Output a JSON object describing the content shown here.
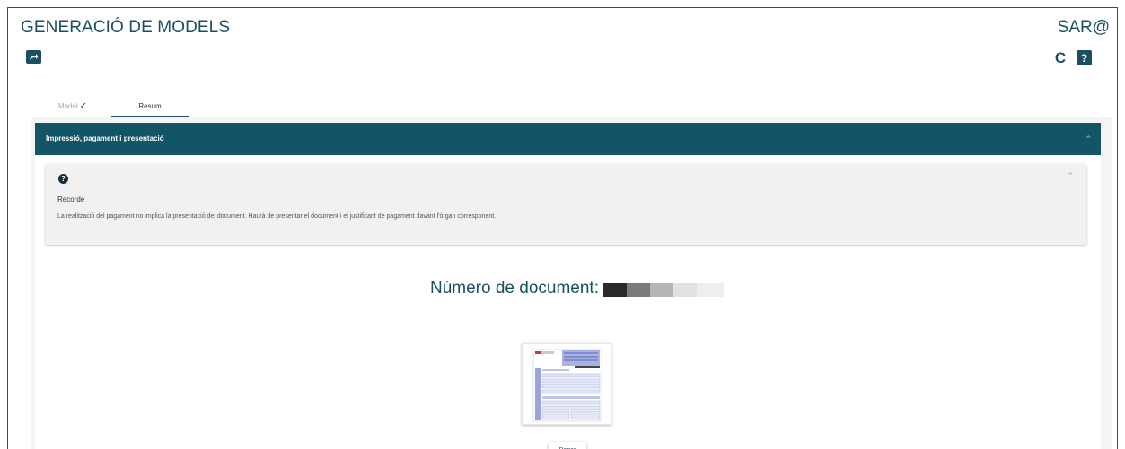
{
  "header": {
    "title": "GENERACIÓ DE MODELS",
    "brand": "SAR@"
  },
  "toolbar": {
    "export_icon": "export-icon",
    "refresh_icon": "refresh-icon",
    "refresh_glyph": "C",
    "help_icon": "help-icon",
    "help_glyph": "?"
  },
  "tabs": [
    {
      "label": "Model",
      "completed": true,
      "active": false
    },
    {
      "label": "Resum",
      "completed": false,
      "active": true
    }
  ],
  "section": {
    "title": "Impressió, pagament i presentació",
    "info": {
      "title": "Recorde",
      "text": "La realització del pagament no implica la presentació del document. Haurà de presentar el document i el justificant de pagament davant l'òrgan corresponent."
    },
    "document_number_label": "Número de document:",
    "pay_label": "Pagar"
  },
  "colors": {
    "primary": "#135466",
    "brand_text": "#1a4f63",
    "background": "#f4f4f4"
  }
}
